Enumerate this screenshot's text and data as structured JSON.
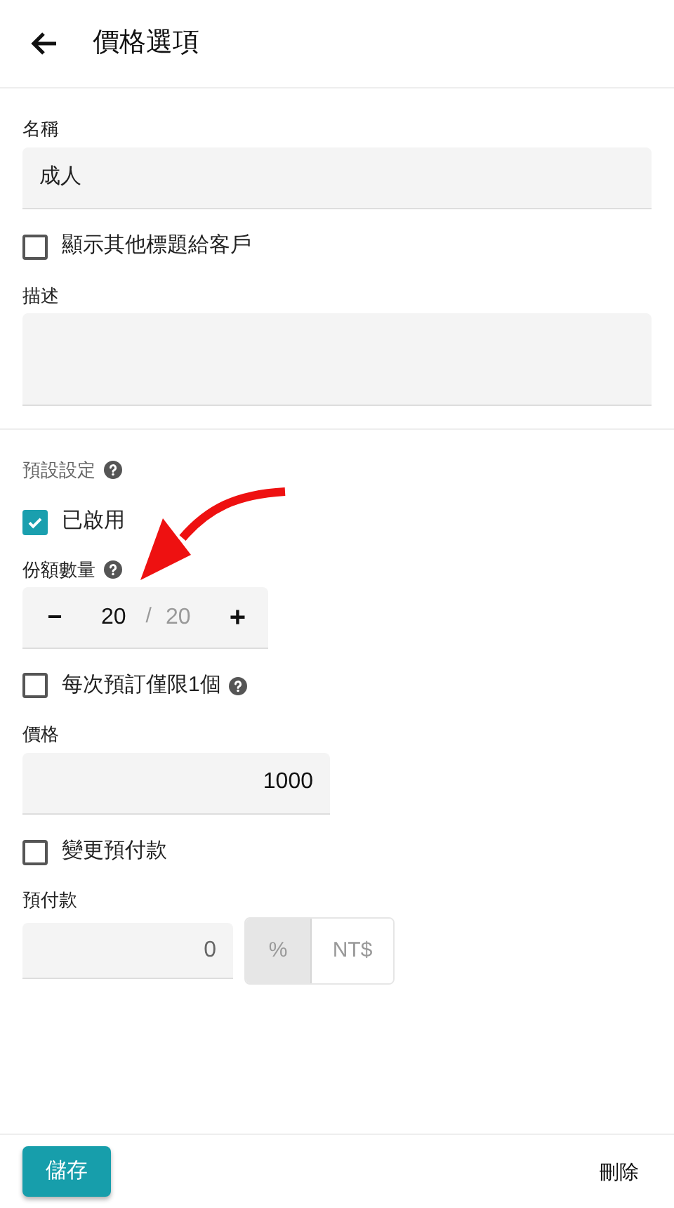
{
  "header": {
    "title": "價格選項"
  },
  "name_field": {
    "label": "名稱",
    "value": "成人"
  },
  "show_other_title": {
    "label": "顯示其他標題給客戶",
    "checked": false
  },
  "description_field": {
    "label": "描述"
  },
  "defaults": {
    "label": "預設設定"
  },
  "enabled": {
    "label": "已啟用",
    "checked": true
  },
  "quota": {
    "label": "份額數量",
    "minus": "−",
    "value": "20",
    "separator": "/",
    "max": "20",
    "plus": "+"
  },
  "one_per_booking": {
    "label": "每次預訂僅限1個",
    "checked": false
  },
  "price_field": {
    "label": "價格",
    "value": "1000"
  },
  "change_deposit": {
    "label": "變更預付款",
    "checked": false
  },
  "deposit": {
    "label": "預付款",
    "value": "0",
    "units": [
      {
        "label": "%",
        "selected": true
      },
      {
        "label": "NT$",
        "selected": false
      }
    ]
  },
  "footer": {
    "save": "儲存",
    "delete": "刪除"
  }
}
